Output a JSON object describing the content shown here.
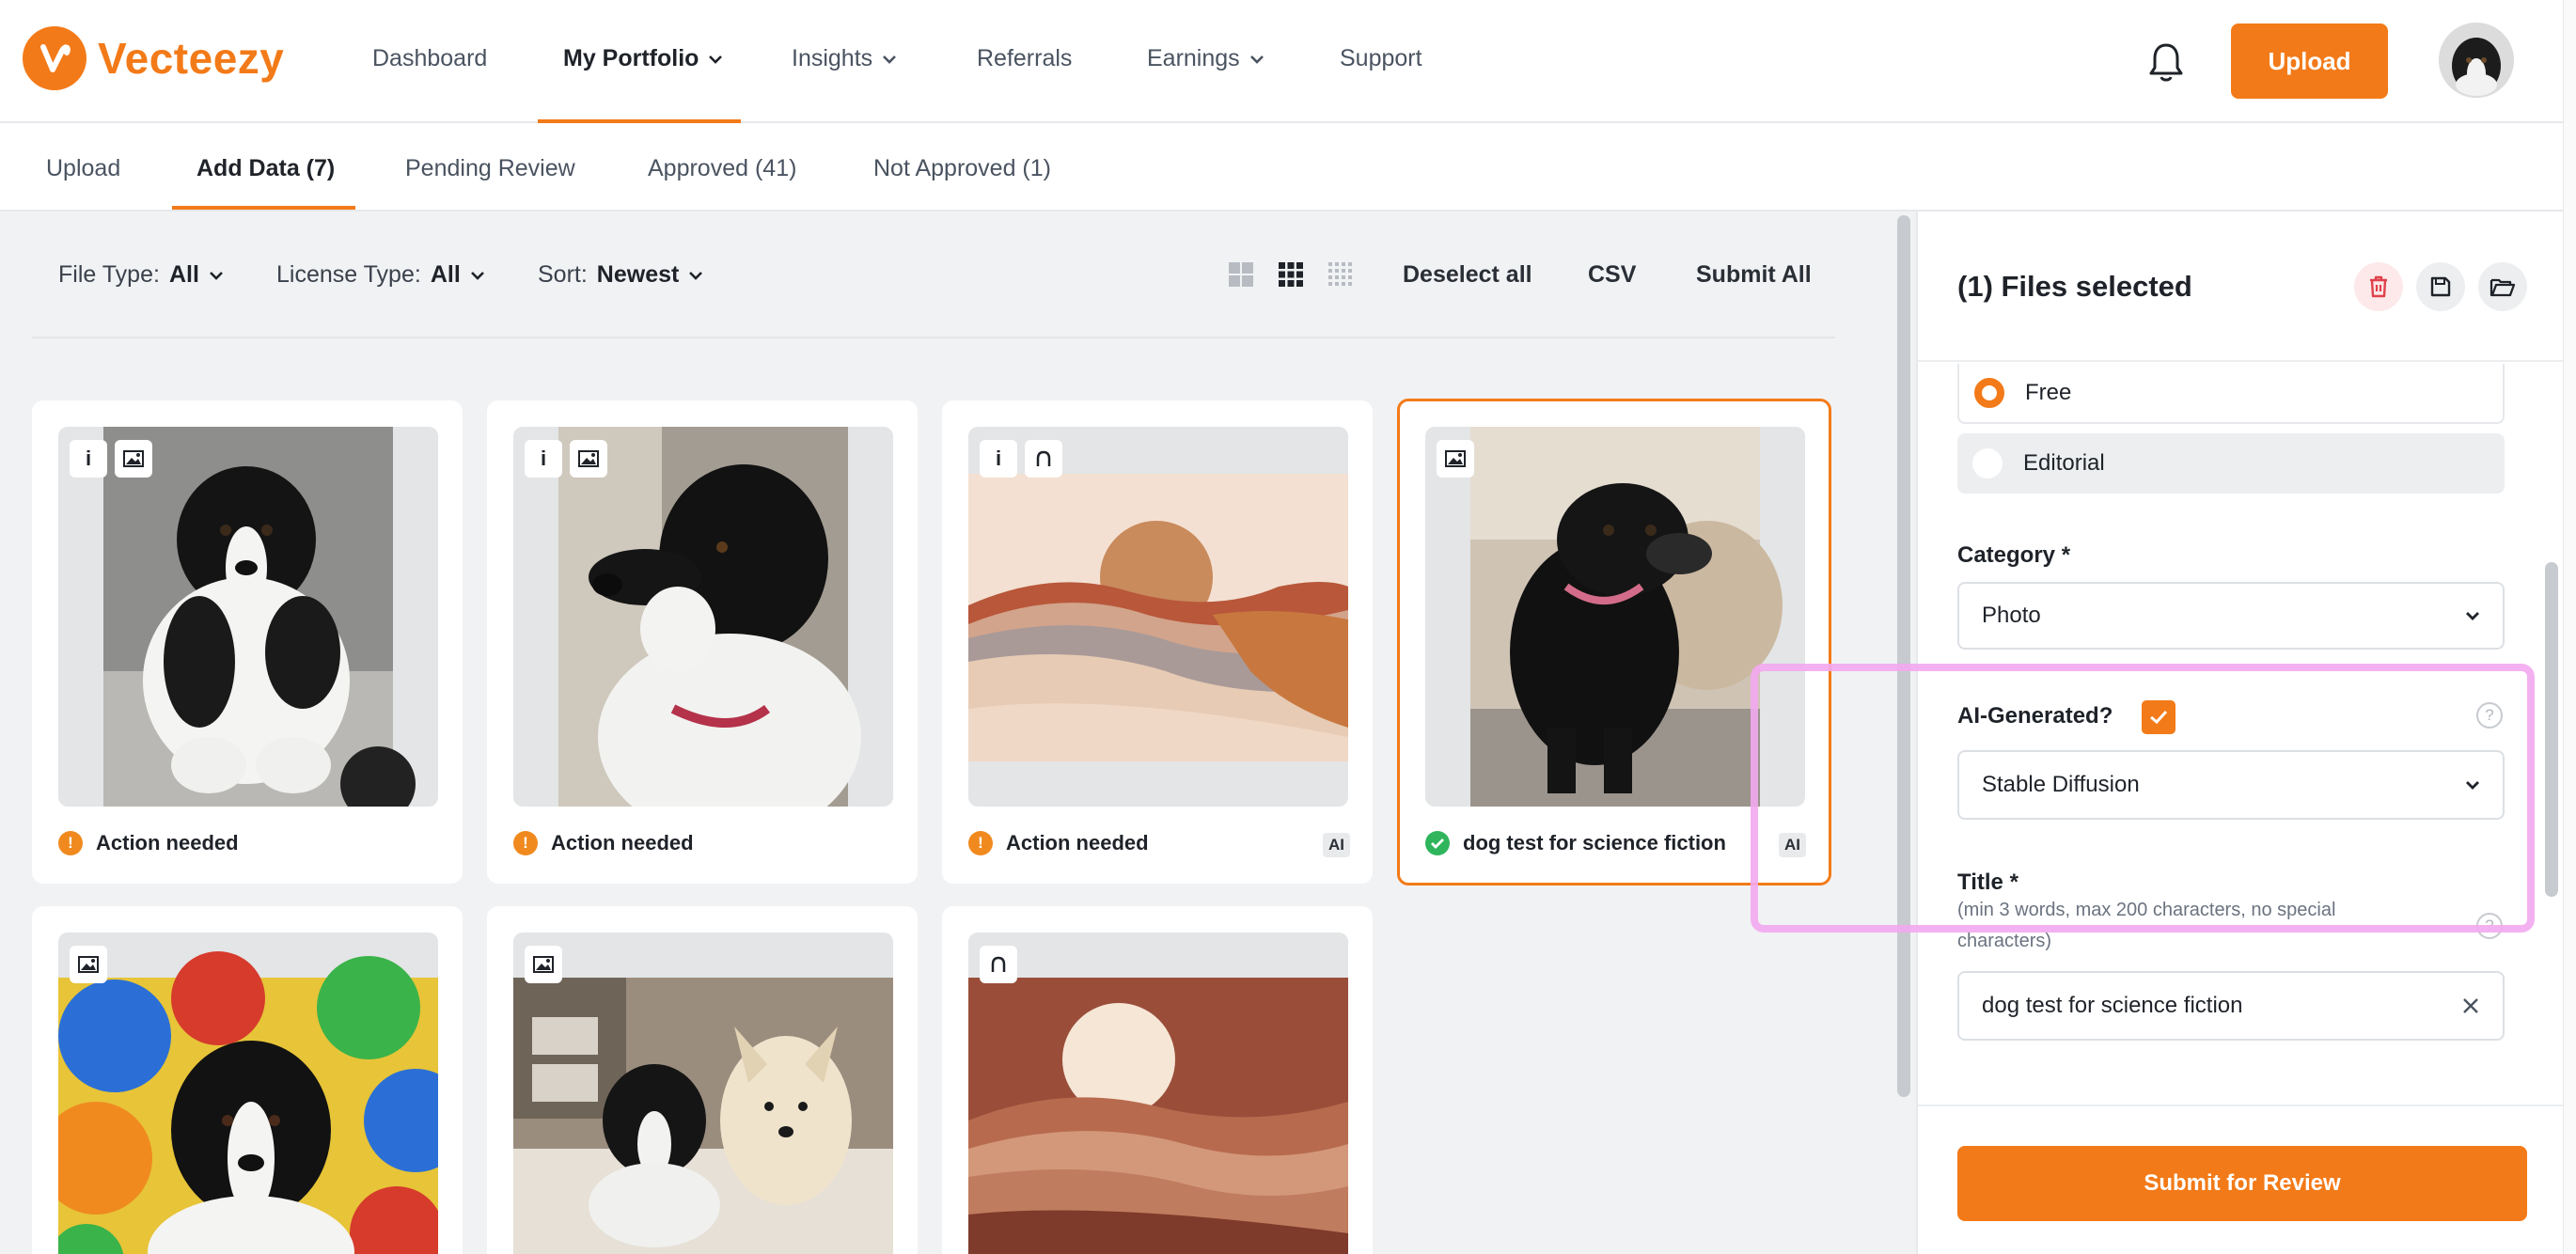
{
  "brand": {
    "name": "Vecteezy",
    "accent": "#f37a18"
  },
  "nav": {
    "items": [
      {
        "label": "Dashboard"
      },
      {
        "label": "My Portfolio"
      },
      {
        "label": "Insights"
      },
      {
        "label": "Referrals"
      },
      {
        "label": "Earnings"
      },
      {
        "label": "Support"
      }
    ],
    "upload_label": "Upload"
  },
  "subtabs": [
    {
      "label": "Upload"
    },
    {
      "label": "Add Data (7)"
    },
    {
      "label": "Pending Review"
    },
    {
      "label": "Approved (41)"
    },
    {
      "label": "Not Approved (1)"
    }
  ],
  "toolbar": {
    "file_type_label": "File Type:",
    "file_type_value": "All",
    "license_type_label": "License Type:",
    "license_type_value": "All",
    "sort_label": "Sort:",
    "sort_value": "Newest",
    "deselect_all": "Deselect all",
    "csv": "CSV",
    "submit_all": "Submit All"
  },
  "cards": [
    {
      "status": "Action needed",
      "status_type": "warning",
      "ai": ""
    },
    {
      "status": "Action needed",
      "status_type": "warning",
      "ai": ""
    },
    {
      "status": "Action needed",
      "status_type": "warning",
      "ai": "AI"
    },
    {
      "status": "dog test for science fiction",
      "status_type": "ok",
      "ai": "AI"
    }
  ],
  "panel": {
    "title": "(1) Files selected",
    "license_options": [
      "Free",
      "Editorial"
    ],
    "category_label": "Category *",
    "category_value": "Photo",
    "ai_label": "AI-Generated?",
    "ai_checked": true,
    "ai_tool_value": "Stable Diffusion",
    "title_label": "Title *",
    "title_hint": "(min 3 words, max 200 characters, no special characters)",
    "title_value": "dog test for science fiction",
    "help_glyph": "?",
    "submit_label": "Submit for Review"
  }
}
